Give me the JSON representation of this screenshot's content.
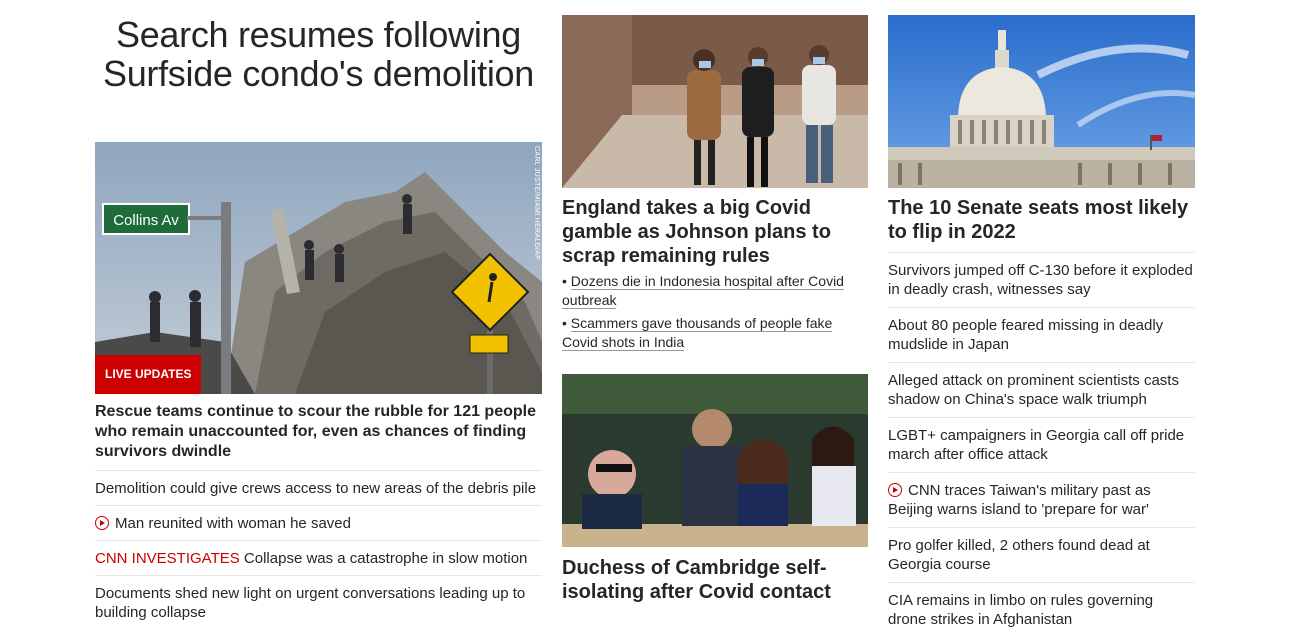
{
  "hero": {
    "title": "Search resumes following Surfside condo's demolition",
    "image_credit": "CARL JUSTE/MIAMI HERALD/AP",
    "sign_text": "Collins Av",
    "live_badge": "LIVE UPDATES",
    "lead_text": "Rescue teams continue to scour the rubble for 121 people who remain unaccounted for, even as chances of finding survivors dwindle",
    "links": [
      {
        "kicker": "",
        "text": "Demolition could give crews access to new areas of the debris pile",
        "video": false
      },
      {
        "kicker": "",
        "text": "Man reunited with woman he saved",
        "video": true
      },
      {
        "kicker": "CNN INVESTIGATES",
        "text": " Collapse was a catastrophe in slow motion",
        "video": false
      },
      {
        "kicker": "",
        "text": "Documents shed new light on urgent conversations leading up to building collapse",
        "video": false
      }
    ]
  },
  "england": {
    "headline": "England takes a big Covid gamble as Johnson plans to scrap remaining rules",
    "bullets": [
      "Dozens die in Indonesia hospital after Covid outbreak",
      "Scammers gave thousands of people fake Covid shots in India"
    ]
  },
  "duchess": {
    "headline": "Duchess of Cambridge self-isolating after Covid contact"
  },
  "senate": {
    "headline": "The 10 Senate seats most likely to flip in 2022",
    "links": [
      {
        "text": "Survivors jumped off C-130 before it exploded in deadly crash, witnesses say",
        "video": false
      },
      {
        "text": "About 80 people feared missing in deadly mudslide in Japan",
        "video": false
      },
      {
        "text": "Alleged attack on prominent scientists casts shadow on China's space walk triumph",
        "video": false
      },
      {
        "text": "LGBT+ campaigners in Georgia call off pride march after office attack",
        "video": false
      },
      {
        "text": "CNN traces Taiwan's military past as Beijing warns island to 'prepare for war'",
        "video": true
      },
      {
        "text": "Pro golfer killed, 2 others found dead at Georgia course",
        "video": false
      },
      {
        "text": "CIA remains in limbo on rules governing drone strikes in Afghanistan",
        "video": false
      }
    ]
  },
  "colors": {
    "accent": "#cc0000",
    "text": "#262626",
    "divider": "#e6e6e6"
  }
}
